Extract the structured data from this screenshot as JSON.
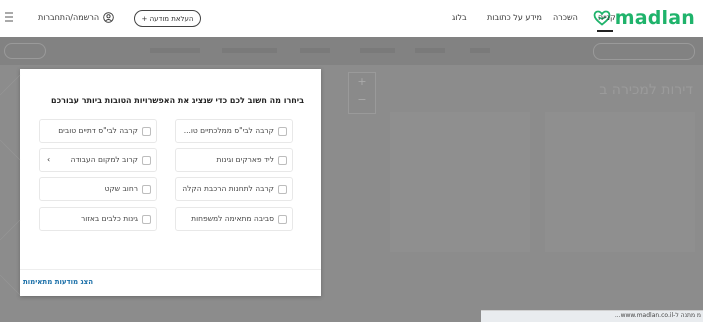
{
  "header": {
    "logo_text": "madlan",
    "nav": [
      "קנייה",
      "השכרה",
      "מידע על כתובות",
      "בלוג"
    ],
    "publish_button": "+ העלאת מודעה",
    "login_label": "הרשמה/התחברות"
  },
  "page": {
    "title": "דירות למכירה ב"
  },
  "modal": {
    "title": "ביחרו מה חשוב לכם כדי שנציג את האפשרויות הטובות ביותר עבורכם",
    "options": [
      {
        "label": "קרבה לבי\"ס ממלכתיים טו...",
        "has_chevron": false
      },
      {
        "label": "קרבה לבי\"ס דתיים טובים",
        "has_chevron": false
      },
      {
        "label": "ליד פארקים וגינות",
        "has_chevron": false
      },
      {
        "label": "קרוב למקום העבודה",
        "has_chevron": true
      },
      {
        "label": "קרבה לתחנות הרכבת הקלה",
        "has_chevron": false
      },
      {
        "label": "רחוב שקט",
        "has_chevron": false
      },
      {
        "label": "סביבה מתאימה למשפחות",
        "has_chevron": false
      },
      {
        "label": "גינות כלבים באזור",
        "has_chevron": false
      }
    ],
    "footer_link": "הצג מודעות מתאימות"
  },
  "status_bar": {
    "text": "...www.madlan.co.il-מ מתנה ל"
  },
  "colors": {
    "brand_green": "#1fb36b",
    "link_blue": "#1a6fa8",
    "overlay_gray": "#8c8c8c"
  }
}
